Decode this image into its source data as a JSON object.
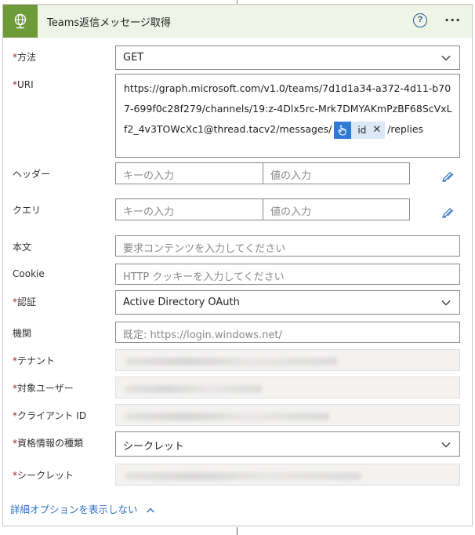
{
  "header": {
    "title": "Teams返信メッセージ取得",
    "help_glyph": "?",
    "more_glyph": "···",
    "accent_color": "#6e9b3a",
    "header_bg": "#eef4e6"
  },
  "fields": {
    "method": {
      "label": "方法",
      "value": "GET"
    },
    "uri": {
      "label": "URI",
      "value_prefix": "https://graph.microsoft.com/v1.0/teams/7d1d1a34-a372-4d11-b707-699f0c28f279/channels/19:z-4Dlx5rc-Mrk7DMYAKmPzBF68ScVxLf2_4v3TOWcXc1@thread.tacv2/messages/",
      "token_label": "id",
      "token_close": "✕",
      "value_suffix": "/replies"
    },
    "headers": {
      "label": "ヘッダー",
      "key_placeholder": "キーの入力",
      "value_placeholder": "値の入力"
    },
    "queries": {
      "label": "クエリ",
      "key_placeholder": "キーの入力",
      "value_placeholder": "値の入力"
    },
    "body": {
      "label": "本文",
      "placeholder": "要求コンテンツを入力してください"
    },
    "cookie": {
      "label": "Cookie",
      "placeholder": "HTTP クッキーを入力してください"
    },
    "auth": {
      "label": "認証",
      "value": "Active Directory OAuth"
    },
    "authority": {
      "label": "機関",
      "placeholder": "既定: https://login.windows.net/"
    },
    "tenant": {
      "label": "テナント"
    },
    "audience": {
      "label": "対象ユーザー"
    },
    "client_id": {
      "label": "クライアント ID"
    },
    "credential_type": {
      "label": "資格情報の種類",
      "value": "シークレット"
    },
    "secret": {
      "label": "シークレット"
    }
  },
  "required_mark": "*",
  "footer": {
    "toggle_label": "詳細オプションを表示しない",
    "chevron": "^"
  }
}
